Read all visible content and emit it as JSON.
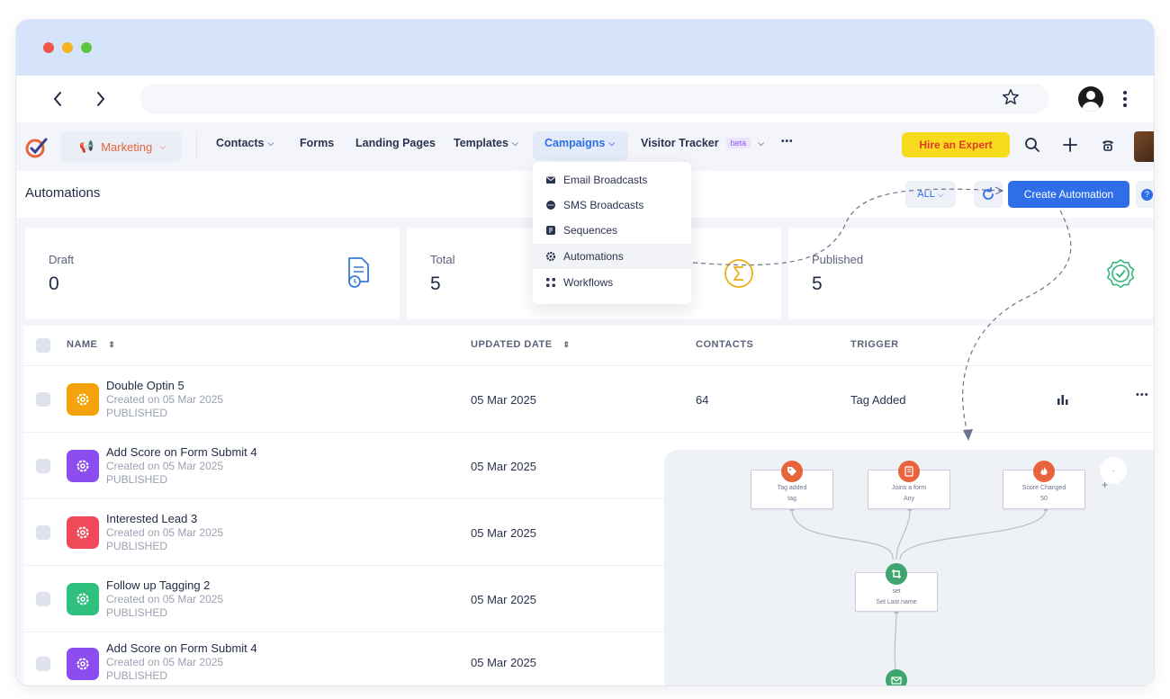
{
  "browser": {
    "back_glyph": "‹",
    "forward_glyph": "›",
    "star_glyph": "☆",
    "more_glyph": "⋮"
  },
  "nav": {
    "workspace_label": "Marketing",
    "items": [
      {
        "label": "Contacts",
        "chevron": true
      },
      {
        "label": "Forms",
        "chevron": false
      },
      {
        "label": "Landing Pages",
        "chevron": false
      },
      {
        "label": "Templates",
        "chevron": true
      },
      {
        "label": "Campaigns",
        "chevron": true,
        "active": true
      },
      {
        "label": "Visitor Tracker",
        "chevron": true,
        "badge": "beta"
      }
    ],
    "more_label": "•••",
    "hire_label": "Hire an Expert"
  },
  "page": {
    "title": "Automations",
    "filter_label": "ALL",
    "create_label": "Create Automation",
    "help_label": "?"
  },
  "campaigns_menu": [
    {
      "label": "Email Broadcasts",
      "icon": "envelope-icon"
    },
    {
      "label": "SMS Broadcasts",
      "icon": "chat-icon"
    },
    {
      "label": "Sequences",
      "icon": "sequence-icon"
    },
    {
      "label": "Automations",
      "icon": "gear-icon",
      "highlighted": true
    },
    {
      "label": "Workflows",
      "icon": "workflow-icon"
    }
  ],
  "stats": [
    {
      "label": "Draft",
      "value": "0",
      "icon": "document-icon"
    },
    {
      "label": "Total",
      "value": "5",
      "icon": "sigma-icon"
    },
    {
      "label": "Published",
      "value": "5",
      "icon": "verified-icon"
    }
  ],
  "table": {
    "columns": {
      "name": "NAME",
      "updated": "UPDATED DATE",
      "contacts": "CONTACTS",
      "trigger": "TRIGGER"
    },
    "rows": [
      {
        "name": "Double Optin 5",
        "created": "Created on 05 Mar 2025",
        "status": "PUBLISHED",
        "updated": "05 Mar 2025",
        "contacts": "64",
        "trigger": "Tag Added",
        "color": "#f5a30a"
      },
      {
        "name": "Add Score on Form Submit 4",
        "created": "Created on 05 Mar 2025",
        "status": "PUBLISHED",
        "updated": "05 Mar 2025",
        "contacts": "",
        "trigger": "",
        "color": "#8b4cf0"
      },
      {
        "name": "Interested Lead 3",
        "created": "Created on 05 Mar 2025",
        "status": "PUBLISHED",
        "updated": "05 Mar 2025",
        "contacts": "",
        "trigger": "",
        "color": "#f04a5a"
      },
      {
        "name": "Follow up Tagging 2",
        "created": "Created on 05 Mar 2025",
        "status": "PUBLISHED",
        "updated": "05 Mar 2025",
        "contacts": "",
        "trigger": "",
        "color": "#2fc07e"
      },
      {
        "name": "Add Score on Form Submit 4",
        "created": "Created on 05 Mar 2025",
        "status": "PUBLISHED",
        "updated": "05 Mar 2025",
        "contacts": "",
        "trigger": "",
        "color": "#8b4cf0"
      }
    ]
  },
  "flow": {
    "nodes": [
      {
        "title": "Tag added",
        "sub": "tag",
        "color": "#e8643c"
      },
      {
        "title": "Joins a form",
        "sub": "Any",
        "color": "#e8643c"
      },
      {
        "title": "Score Changed",
        "sub": "50",
        "color": "#e8643c"
      },
      {
        "title": "set",
        "sub": "Set Last name",
        "color": "#3fa56e"
      }
    ],
    "plus_label": "+"
  },
  "colors": {
    "accent": "#2f6ee8",
    "marketing": "#e8643c",
    "hire_bg": "#f6dc1c"
  }
}
